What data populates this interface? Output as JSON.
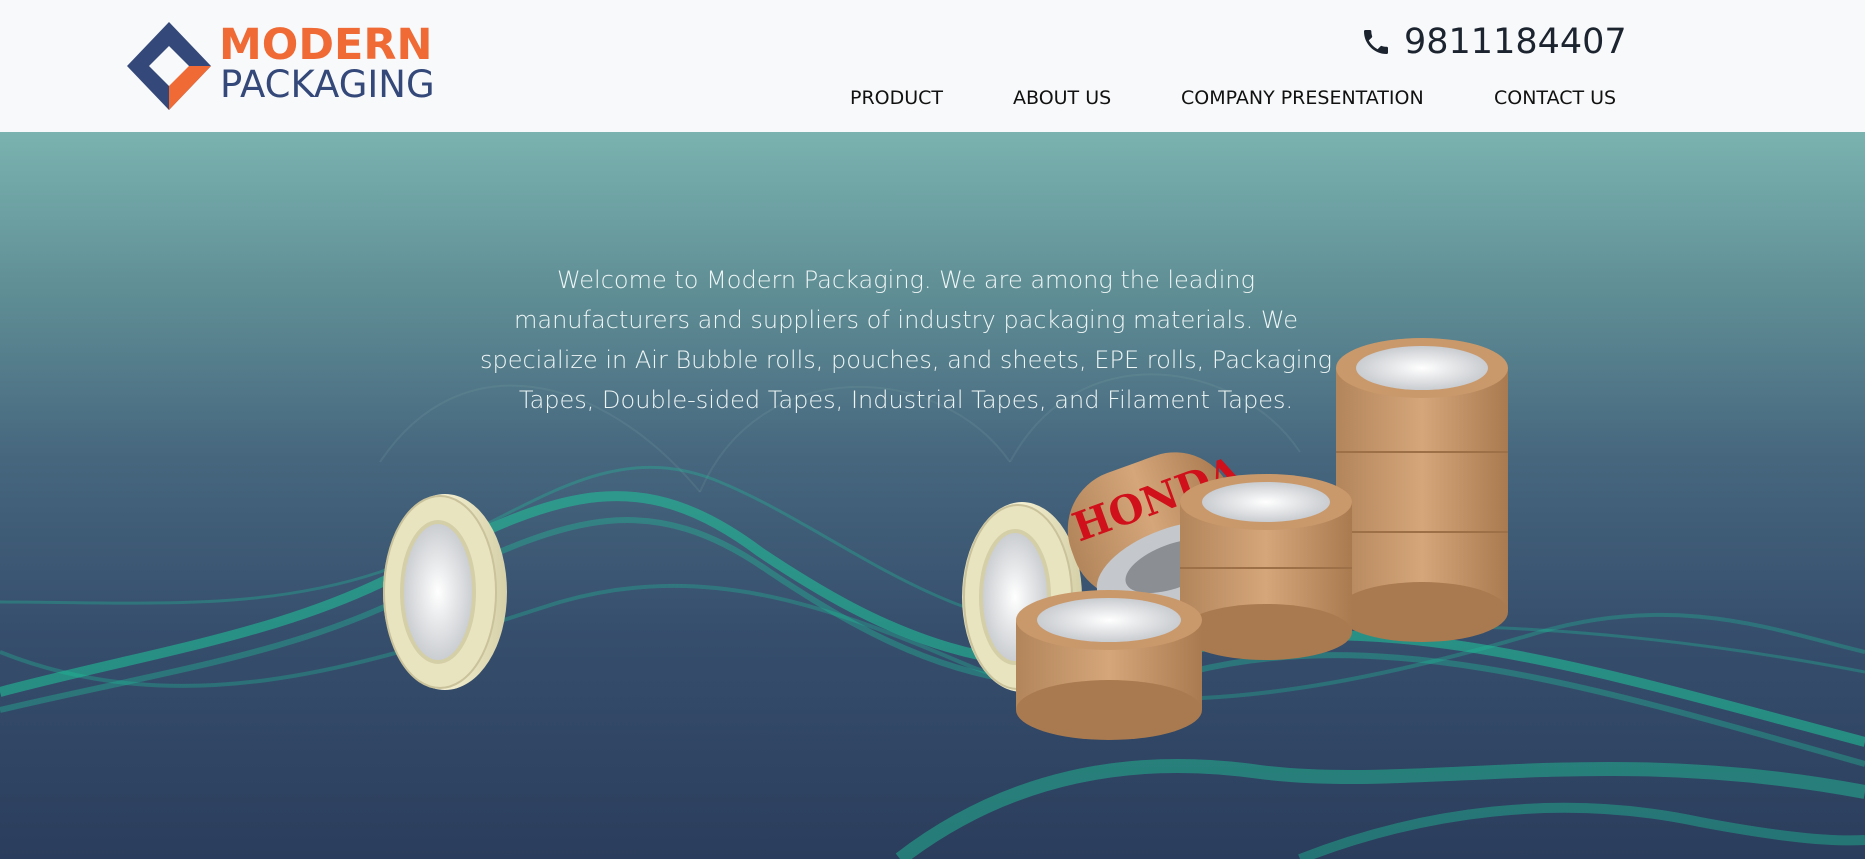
{
  "brand": {
    "word1": "MODERN",
    "word2": "PACKAGING",
    "colors": {
      "orange": "#ef6a35",
      "navy": "#34497a"
    }
  },
  "header": {
    "phone_icon": "phone-icon",
    "phone": "9811184407"
  },
  "nav": {
    "items": [
      {
        "label": "PRODUCT"
      },
      {
        "label": "ABOUT US"
      },
      {
        "label": "COMPANY PRESENTATION"
      },
      {
        "label": "CONTACT US"
      }
    ]
  },
  "hero": {
    "intro": "Welcome to Modern Packaging. We are among the leading manufacturers and suppliers of industry packaging materials. We specialize in Air Bubble rolls, pouches, and sheets, EPE rolls, Packaging Tapes, Double-sided Tapes, Industrial Tapes, and Filament Tapes.",
    "tape_print": "HONDA",
    "colors": {
      "top": "#7ab3b0",
      "bottom": "#2b3d5c",
      "wave": "#1fc79a"
    }
  }
}
